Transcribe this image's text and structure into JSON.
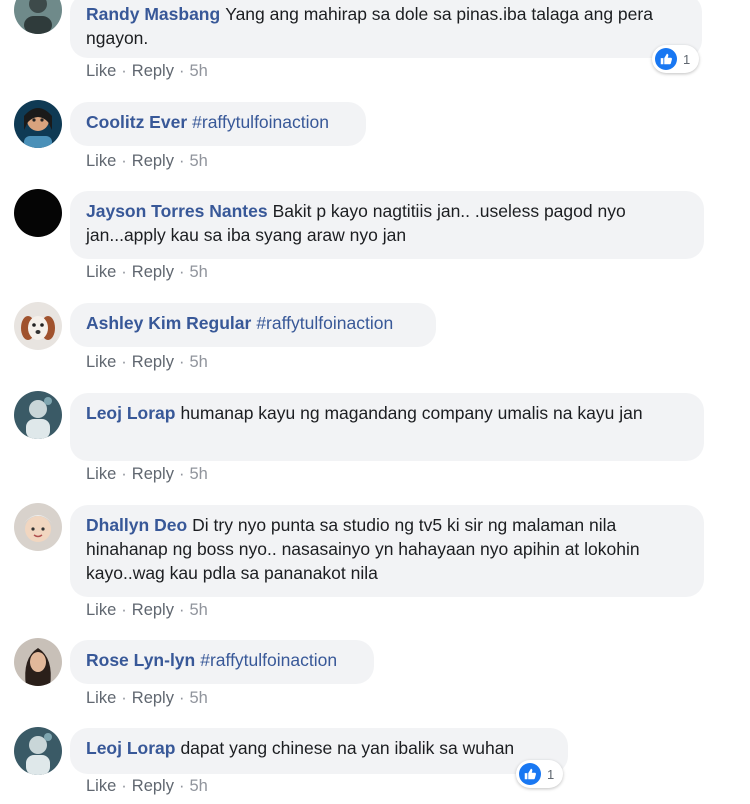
{
  "colors": {
    "author": "#385898",
    "bubble": "#f2f3f5",
    "meta": "#90949c",
    "like": "#1877f2"
  },
  "comments": [
    {
      "author": "Randy Masbang",
      "text": "Yang ang mahirap sa dole sa pinas.iba talaga ang pera ngayon.",
      "like": "Like",
      "reply": "Reply",
      "time": "5h",
      "reactions": "1"
    },
    {
      "author": "Coolitz Ever",
      "text": "#raffytulfoinaction",
      "like": "Like",
      "reply": "Reply",
      "time": "5h"
    },
    {
      "author": "Jayson Torres Nantes",
      "text": "Bakit p kayo nagtitiis jan.. .useless pagod nyo jan...apply kau sa iba syang araw nyo jan",
      "like": "Like",
      "reply": "Reply",
      "time": "5h"
    },
    {
      "author": "Ashley Kim Regular",
      "text": "#raffytulfoinaction",
      "like": "Like",
      "reply": "Reply",
      "time": "5h"
    },
    {
      "author": "Leoj Lorap",
      "text": "humanap kayu ng magandang company umalis na kayu jan",
      "like": "Like",
      "reply": "Reply",
      "time": "5h"
    },
    {
      "author": "Dhallyn Deo",
      "text": "Di try nyo punta sa studio ng tv5 ki sir ng malaman nila hinahanap ng boss nyo.. nasasainyo yn hahayaan nyo apihin at lokohin kayo..wag kau pdla sa pananakot nila",
      "like": "Like",
      "reply": "Reply",
      "time": "5h"
    },
    {
      "author": "Rose Lyn-lyn",
      "text": "#raffytulfoinaction",
      "like": "Like",
      "reply": "Reply",
      "time": "5h"
    },
    {
      "author": "Leoj Lorap",
      "text": "dapat yang chinese na yan ibalik sa wuhan",
      "like": "Like",
      "reply": "Reply",
      "time": "5h",
      "reactions": "1"
    }
  ],
  "separator": "·"
}
